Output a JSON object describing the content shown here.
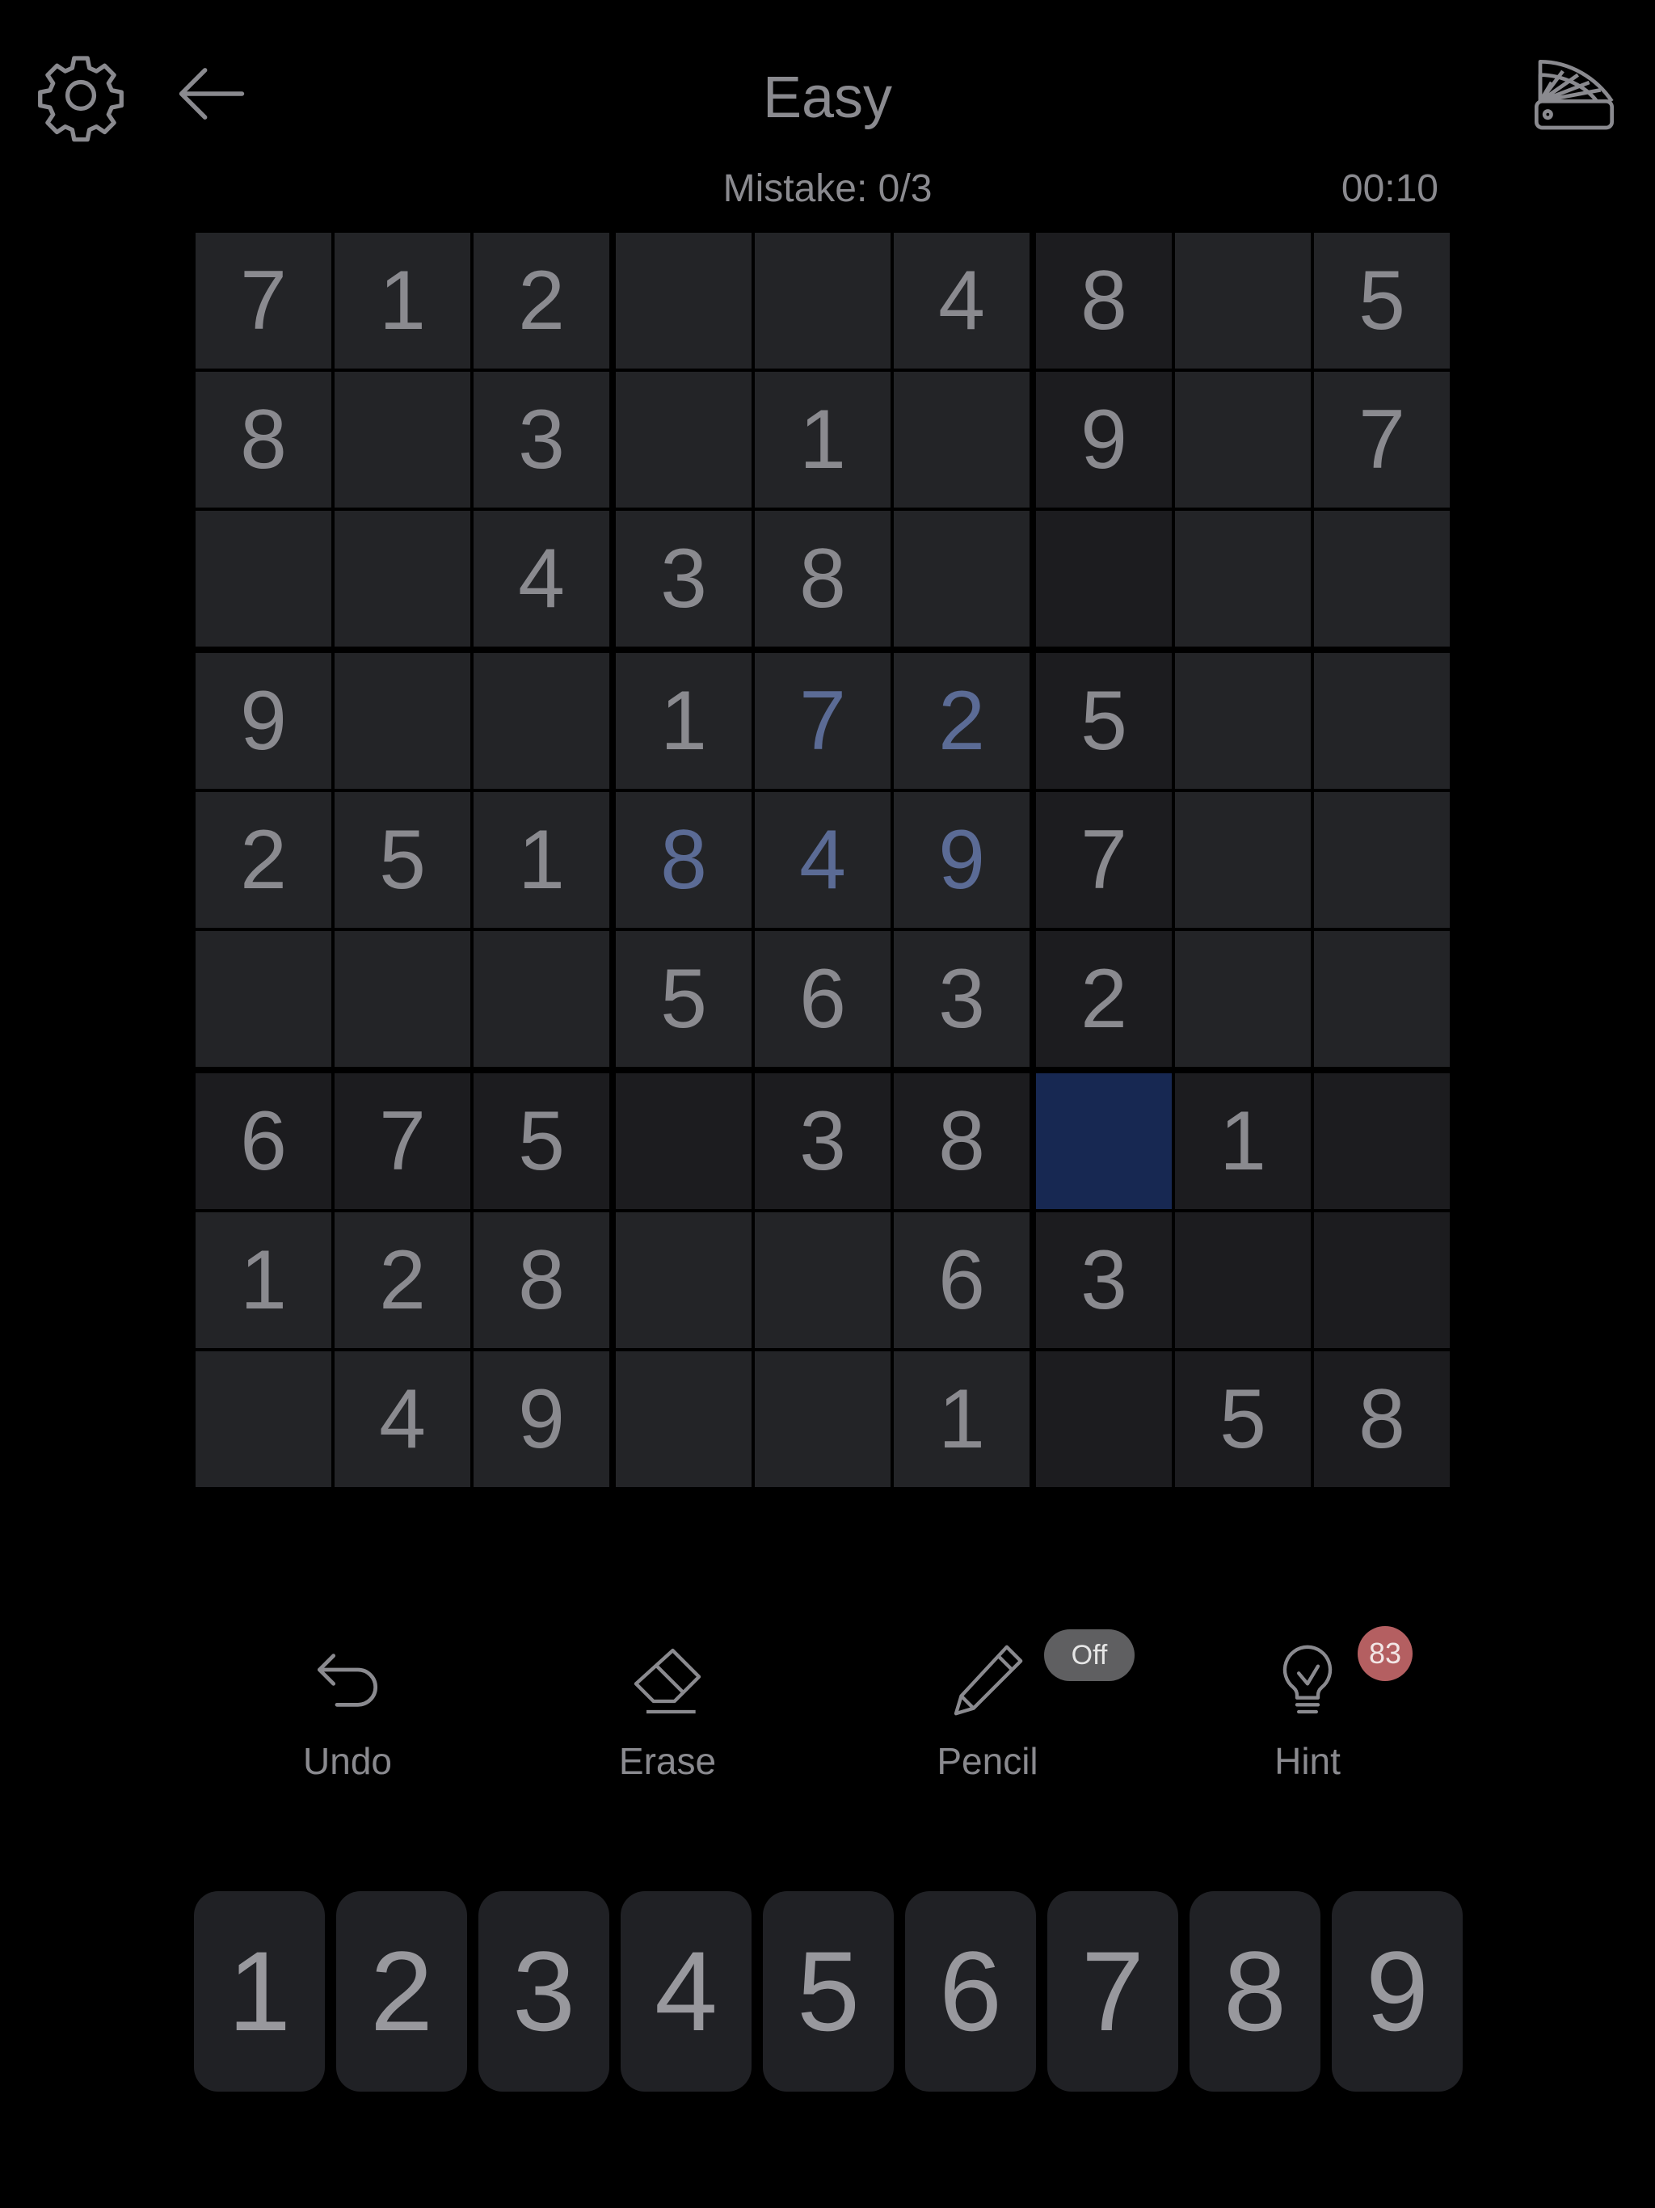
{
  "header": {
    "title": "Easy",
    "mistake": "Mistake: 0/3",
    "timer": "00:10",
    "icons": {
      "settings": "gear-icon",
      "back": "arrow-left-icon",
      "theme": "color-palette-fan-icon"
    }
  },
  "board": {
    "selected": [
      6,
      6
    ],
    "colors": {
      "given_text": "#8a8a8f",
      "user_text": "#5b6b95",
      "cell_bg": "#232427",
      "region_bg": "#1c1c1f",
      "selected_bg": "#172852"
    },
    "cells": [
      [
        "7",
        "1",
        "2",
        "",
        "",
        "4",
        "8",
        "",
        "5"
      ],
      [
        "8",
        "",
        "3",
        "",
        "1",
        "",
        "9",
        "",
        "7"
      ],
      [
        "",
        "",
        "4",
        "3",
        "8",
        "",
        "",
        "",
        ""
      ],
      [
        "9",
        "",
        "",
        "1",
        "7",
        "2",
        "5",
        "",
        ""
      ],
      [
        "2",
        "5",
        "1",
        "8",
        "4",
        "9",
        "7",
        "",
        ""
      ],
      [
        "",
        "",
        "",
        "5",
        "6",
        "3",
        "2",
        "",
        ""
      ],
      [
        "6",
        "7",
        "5",
        "",
        "3",
        "8",
        "",
        "1",
        ""
      ],
      [
        "1",
        "2",
        "8",
        "",
        "",
        "6",
        "3",
        "",
        ""
      ],
      [
        "",
        "4",
        "9",
        "",
        "",
        "1",
        "",
        "5",
        "8"
      ]
    ],
    "user_entered": [
      [
        3,
        4
      ],
      [
        3,
        5
      ],
      [
        4,
        3
      ],
      [
        4,
        4
      ],
      [
        4,
        5
      ]
    ]
  },
  "toolbar": {
    "undo": {
      "label": "Undo",
      "icon": "undo-arrow-icon"
    },
    "erase": {
      "label": "Erase",
      "icon": "eraser-icon"
    },
    "pencil": {
      "label": "Pencil",
      "icon": "pencil-icon",
      "badge": "Off"
    },
    "hint": {
      "label": "Hint",
      "icon": "lightbulb-icon",
      "badge": "83"
    }
  },
  "numpad": [
    "1",
    "2",
    "3",
    "4",
    "5",
    "6",
    "7",
    "8",
    "9"
  ]
}
